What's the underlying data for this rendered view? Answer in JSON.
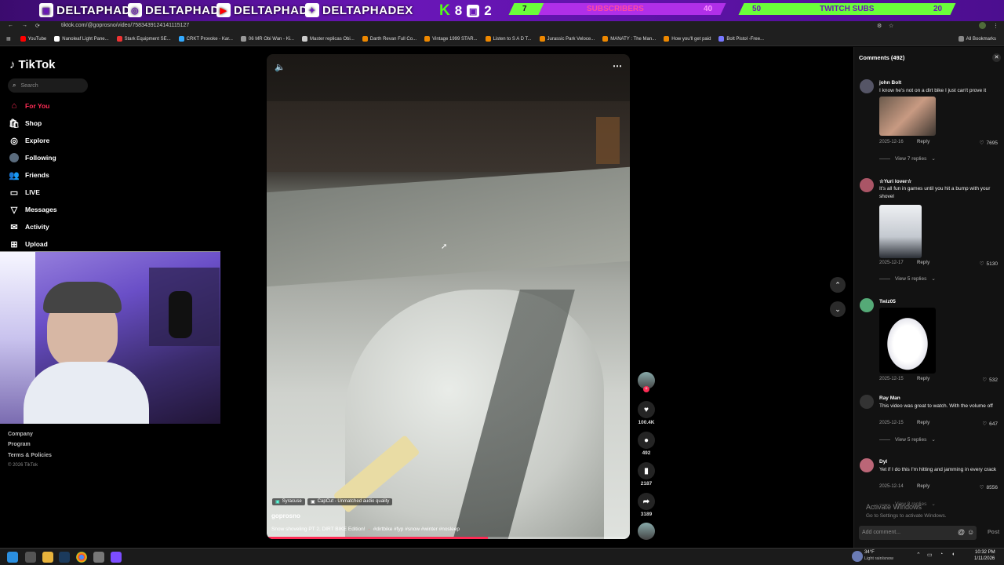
{
  "overlay": {
    "handles": [
      "DELTAPHADE",
      "DELTAPHADE",
      "DELTAPHADE",
      "DELTAPHADEX"
    ],
    "kick_count": "8",
    "twitch_count": "2",
    "subscribers": {
      "current": "7",
      "label": "SUBSCRIBERS",
      "goal": "40"
    },
    "twitch_subs": {
      "current": "50",
      "label": "TWITCH SUBS",
      "goal": "20"
    }
  },
  "browser": {
    "url": "tiktok.com/@goprosno/video/7583439124141115127",
    "bookmarks": [
      "YouTube",
      "Nanoleaf Light Pane...",
      "Stark Equipment SE...",
      "CRKT Provoke - Kar...",
      "06 MR Obi Wan - Ki...",
      "Master replicas Obi...",
      "Darth Revan Full Co...",
      "Vintage 1999 STAR...",
      "Listen to S A D T...",
      "Jurassic Park Veloce...",
      "MANATY : The Man...",
      "How you'll get paid",
      "Bolt Pistol -Free..."
    ],
    "all_bookmarks": "All Bookmarks"
  },
  "sidebar": {
    "logo": "TikTok",
    "search_placeholder": "Search",
    "nav": [
      "For You",
      "Shop",
      "Explore",
      "Following",
      "Friends",
      "LIVE",
      "Messages",
      "Activity",
      "Upload"
    ],
    "footer": [
      "Company",
      "Program",
      "Terms & Policies",
      "© 2026 TikTok"
    ]
  },
  "video": {
    "location": "Syracuse",
    "audio": "CapCut - Unmatched audio quality",
    "author": "goprosno",
    "caption": "Snow shoveling PT 2, DIRT BIKE Edition!",
    "hashtags": "#dirtbike #fyp #snow #winter #nosleep",
    "progress": 0.61,
    "likes": "100.4K",
    "comments": "492",
    "saves": "2187",
    "shares": "3189"
  },
  "comments_panel": {
    "title": "Comments (492)",
    "items": [
      {
        "user": "john Bolt",
        "text": "I know he's not on a dirt bike I just can't prove it",
        "date": "2025-12-16",
        "reply": "Reply",
        "likes": "7695",
        "view": "View 7 replies"
      },
      {
        "user": "☆Yuri lover☆",
        "text": "It's all fun in games until you hit a bump with your shovel",
        "date": "2025-12-17",
        "reply": "Reply",
        "likes": "5130",
        "view": "View 5 replies"
      },
      {
        "user": "Twiz05",
        "text": "",
        "date": "2025-12-15",
        "reply": "Reply",
        "likes": "532",
        "view": ""
      },
      {
        "user": "Ray Man",
        "text": "This video was great to watch. With the volume off",
        "date": "2025-12-15",
        "reply": "Reply",
        "likes": "647",
        "view": "View 5 replies"
      },
      {
        "user": "Dyl",
        "text": "Yet if I do this I'm hitting and jamming in every crack",
        "date": "2025-12-14",
        "reply": "Reply",
        "likes": "8556",
        "view": "View 8 replies"
      }
    ],
    "add_placeholder": "Add comment...",
    "post": "Post",
    "activate_title": "Activate Windows",
    "activate_sub": "Go to Settings to activate Windows."
  },
  "taskbar": {
    "weather_temp": "34°F",
    "weather_desc": "Light rain/snow",
    "time": "10:32 PM",
    "date": "1/11/2026"
  }
}
